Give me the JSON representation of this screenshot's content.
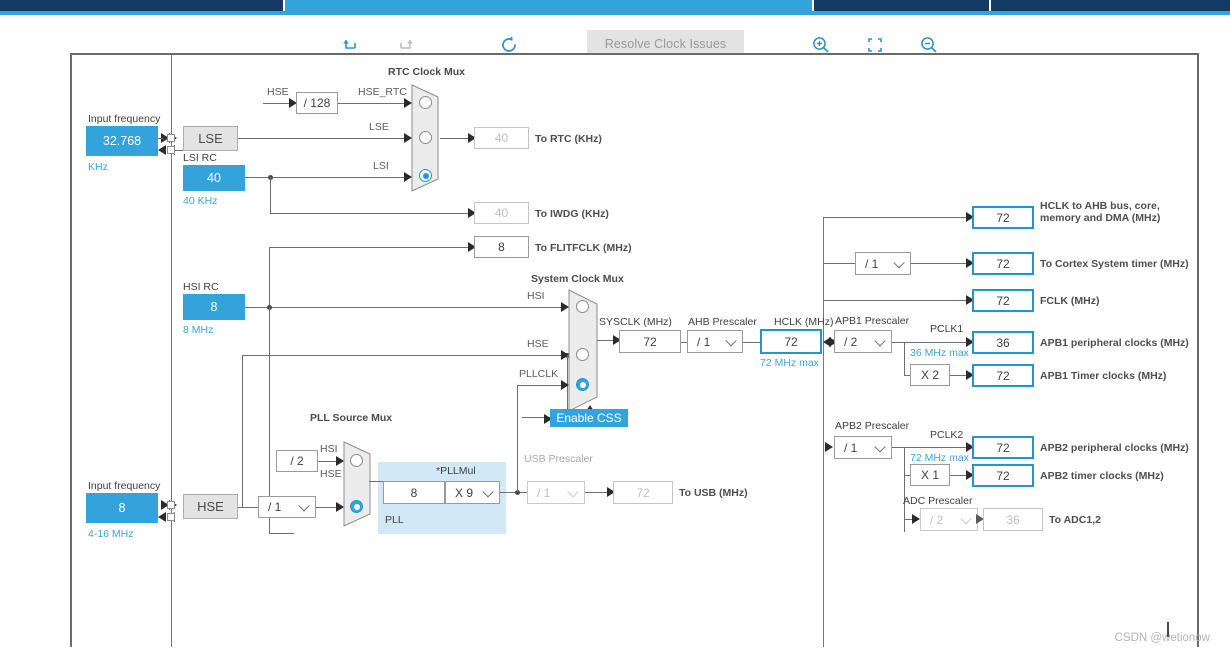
{
  "window": {
    "tabstrip_colors": [
      "#123a63",
      "#34a3dc",
      "#123a63",
      "#34a3dc"
    ],
    "accent": "#34a3dc",
    "dark_blue": "#123a63"
  },
  "toolbar": {
    "undo_icon": "undo-arrow-icon",
    "redo_icon": "redo-arrow-icon",
    "reset_icon": "reset-circular-arrow-icon",
    "resolve_label": "Resolve Clock Issues",
    "zoom_in_icon": "zoom-in-icon",
    "fit_icon": "fit-to-screen-icon",
    "zoom_out_icon": "zoom-out-icon"
  },
  "diagram": {
    "lse": {
      "input_frequency_label": "Input frequency",
      "value": "32.768",
      "unit": "KHz",
      "osc_label": "LSE"
    },
    "lsi": {
      "title": "LSI RC",
      "value": "40",
      "range": "40 KHz"
    },
    "hse_rtc_div": {
      "input_label": "HSE",
      "value": "/ 128",
      "output_label": "HSE_RTC"
    },
    "rtc_mux": {
      "title": "RTC Clock Mux",
      "inputs": [
        "HSE_RTC",
        "LSE",
        "LSI"
      ],
      "selected_index": 2
    },
    "to_rtc": {
      "value": "40",
      "label": "To RTC (KHz)"
    },
    "to_iwdg": {
      "value": "40",
      "label": "To IWDG (KHz)"
    },
    "to_flitfclk": {
      "value": "8",
      "label": "To FLITFCLK (MHz)"
    },
    "hsi": {
      "title": "HSI RC",
      "value": "8",
      "range": "8 MHz"
    },
    "hse": {
      "input_frequency_label": "Input frequency",
      "value": "8",
      "range": "4-16 MHz",
      "osc_label": "HSE",
      "prescaler": "/ 1"
    },
    "system_clock_mux": {
      "title": "System Clock Mux",
      "inputs": [
        "HSI",
        "HSE",
        "PLLCLK"
      ],
      "selected_index": 2
    },
    "enable_css": {
      "label": "Enable CSS"
    },
    "pll_source_mux": {
      "title": "PLL Source Mux",
      "inputs": [
        "HSI",
        "HSE"
      ],
      "selected_index": 1,
      "hsi_div": "/ 2"
    },
    "pll": {
      "region_label": "PLL",
      "input_value": "8",
      "mul_label": "*PLLMul",
      "mul_value": "X 9"
    },
    "usb": {
      "prescaler_title": "USB Prescaler",
      "prescaler_value": "/ 1",
      "value": "72",
      "label": "To USB (MHz)"
    },
    "sysclk": {
      "title": "SYSCLK (MHz)",
      "value": "72"
    },
    "ahb_prescaler": {
      "title": "AHB Prescaler",
      "value": "/ 1"
    },
    "hclk": {
      "title": "HCLK (MHz)",
      "value": "72",
      "max_note": "72 MHz max"
    },
    "outputs_ahb": [
      {
        "value": "72",
        "label": "HCLK to AHB bus, core,\nmemory and DMA (MHz)"
      },
      {
        "value": "72",
        "label": "To Cortex System timer (MHz)"
      },
      {
        "value": "72",
        "label": "FCLK (MHz)"
      }
    ],
    "cortex_prescaler": {
      "value": "/ 1"
    },
    "apb1": {
      "prescaler_title": "APB1 Prescaler",
      "prescaler_value": "/ 2",
      "pclk_label": "PCLK1",
      "max_note": "36 MHz max",
      "peripheral": {
        "value": "36",
        "label": "APB1 peripheral clocks (MHz)"
      },
      "timer_mul": "X 2",
      "timer": {
        "value": "72",
        "label": "APB1 Timer clocks (MHz)"
      }
    },
    "apb2": {
      "prescaler_title": "APB2 Prescaler",
      "prescaler_value": "/ 1",
      "pclk_label": "PCLK2",
      "max_note": "72 MHz max",
      "peripheral": {
        "value": "72",
        "label": "APB2 peripheral clocks (MHz)"
      },
      "timer_mul": "X 1",
      "timer": {
        "value": "72",
        "label": "APB2 timer clocks (MHz)"
      },
      "adc_prescaler_title": "ADC Prescaler",
      "adc_prescaler_value": "/ 2",
      "adc": {
        "value": "36",
        "label": "To ADC1,2"
      }
    }
  },
  "watermark": "CSDN @wetionow"
}
